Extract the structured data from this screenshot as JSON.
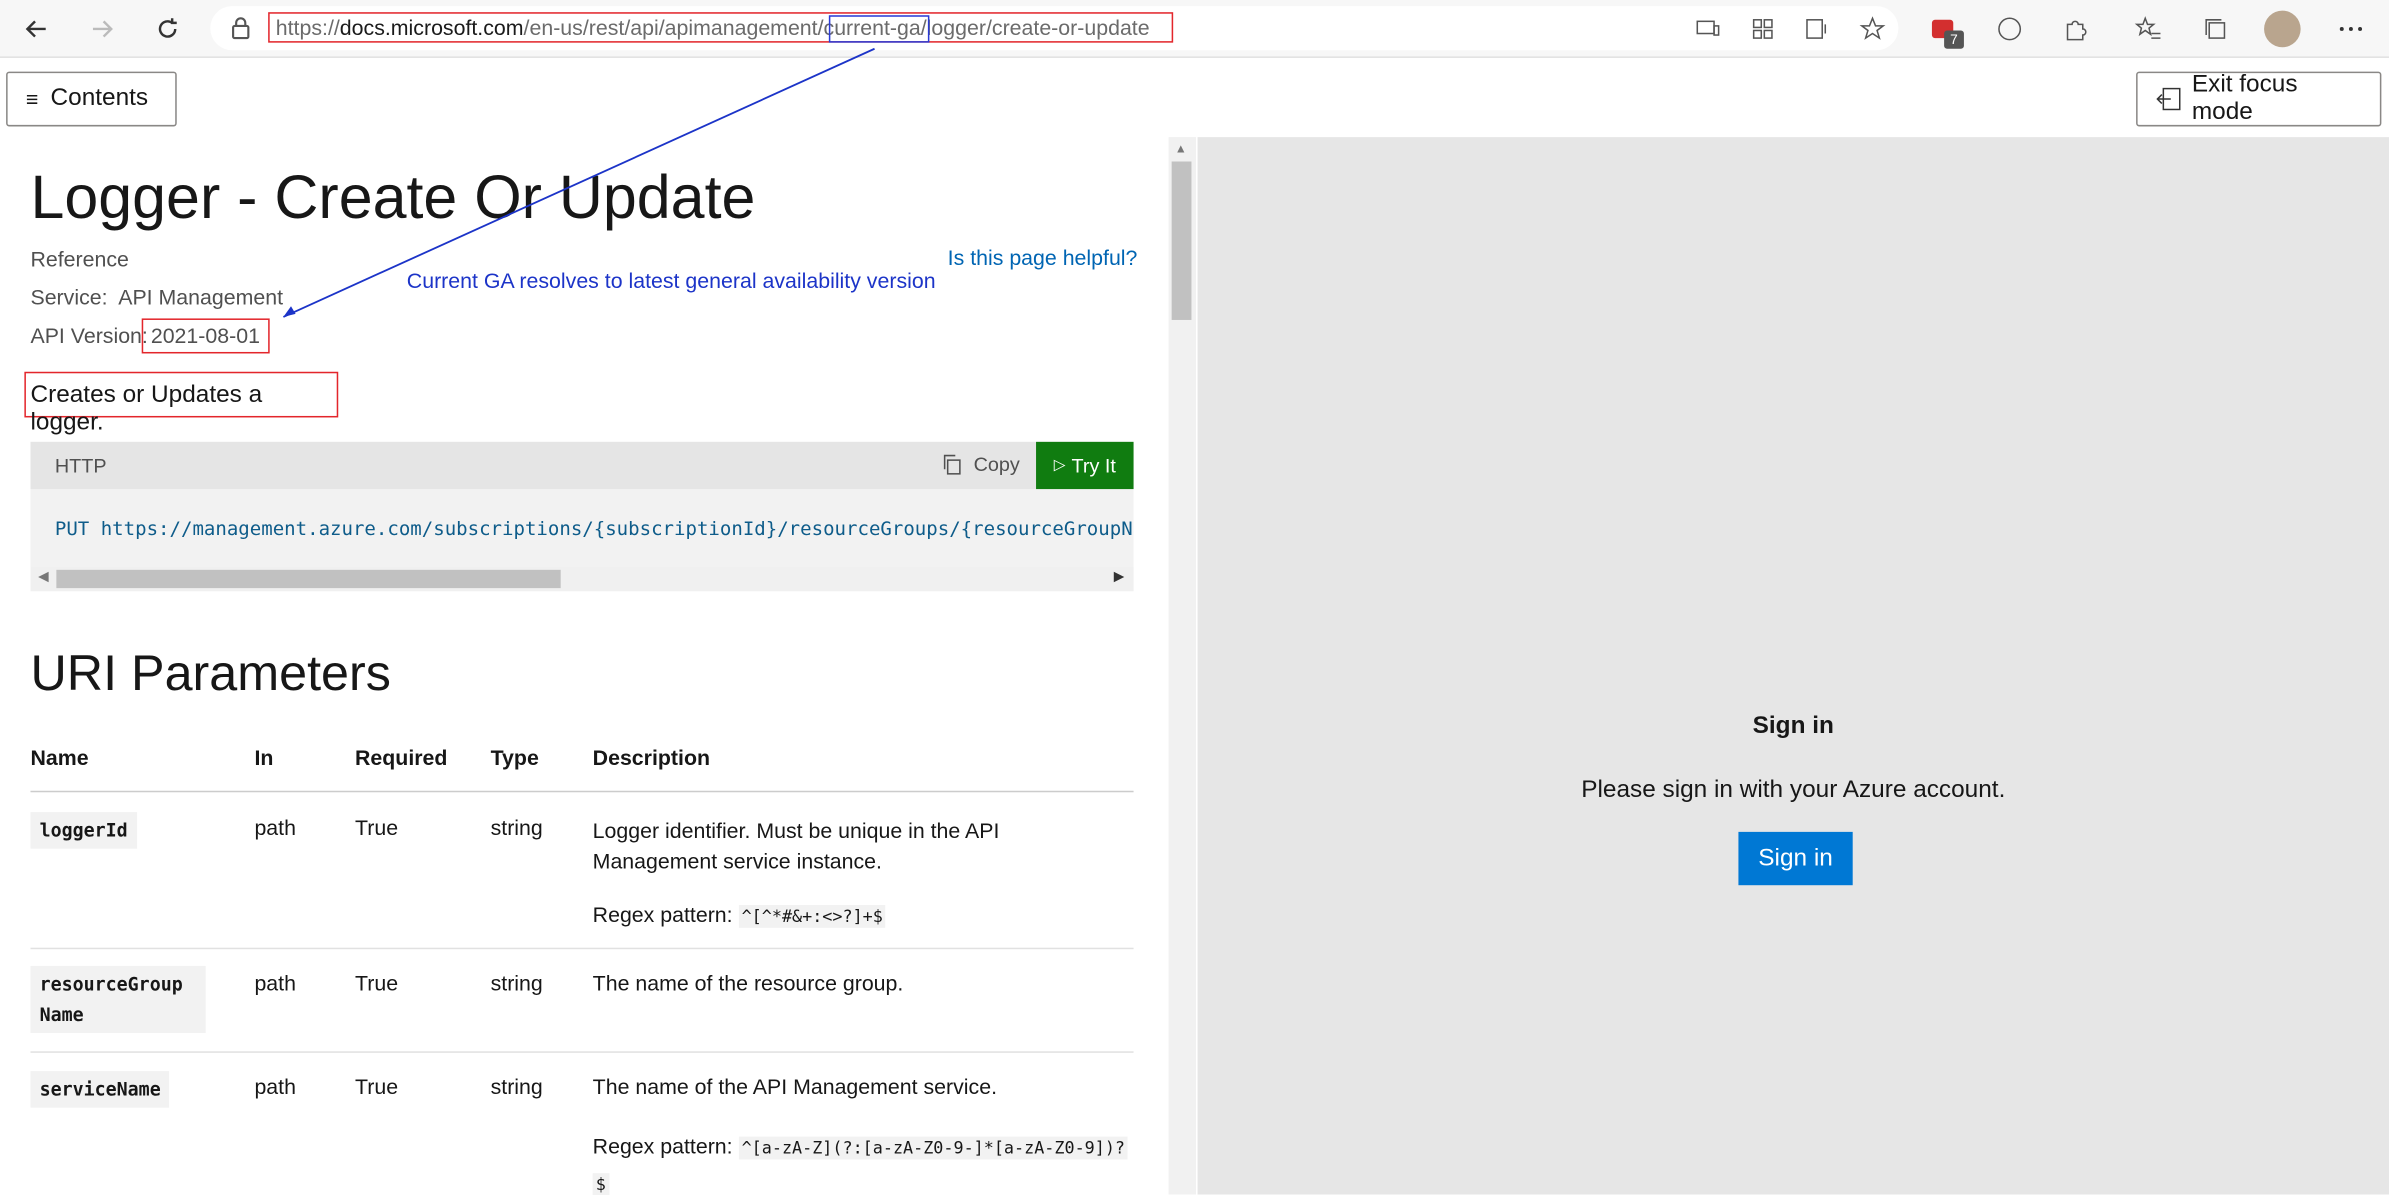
{
  "browser": {
    "url_prefix": "https://",
    "url_host": "docs.microsoft.com",
    "url_path": "/en-us/rest/api/apimanagement/",
    "url_ga": "current-ga",
    "url_rest": "/logger/create-or-update",
    "ext_badge": "7"
  },
  "header": {
    "contents_label": "Contents",
    "exit_focus_label": "Exit focus mode"
  },
  "page": {
    "title": "Logger - Create Or Update",
    "reference": "Reference",
    "service_label": "Service:",
    "service_value": "API Management",
    "api_version_label": "API Version:",
    "api_version_value": "2021-08-01",
    "description": "Creates or Updates a logger.",
    "helpful": "Is this page helpful?",
    "annotation": "Current GA resolves to latest general availability version"
  },
  "code": {
    "lang": "HTTP",
    "copy": "Copy",
    "try_it": "Try It",
    "request": "PUT https://management.azure.com/subscriptions/{subscriptionId}/resourceGroups/{resourceGroupName"
  },
  "uri": {
    "heading": "URI Parameters",
    "columns": [
      "Name",
      "In",
      "Required",
      "Type",
      "Description"
    ],
    "rows": [
      {
        "name": "loggerId",
        "in": "path",
        "required": "True",
        "type": "string",
        "desc1": "Logger identifier. Must be unique in the API",
        "desc2": "Management service instance.",
        "regex_label": "Regex pattern:",
        "regex": "^[^*#&+:<>?]+$"
      },
      {
        "name1": "resourceGroup",
        "name2": "Name",
        "in": "path",
        "required": "True",
        "type": "string",
        "desc1": "The name of the resource group."
      },
      {
        "name": "serviceName",
        "in": "path",
        "required": "True",
        "type": "string",
        "desc1": "The name of the API Management service.",
        "regex_label": "Regex pattern:",
        "regex": "^[a-zA-Z](?:[a-zA-Z0-9-]*[a-zA-Z0-9])?",
        "regex2": "$"
      }
    ]
  },
  "signin": {
    "title": "Sign in",
    "message": "Please sign in with your Azure account.",
    "button": "Sign in"
  }
}
